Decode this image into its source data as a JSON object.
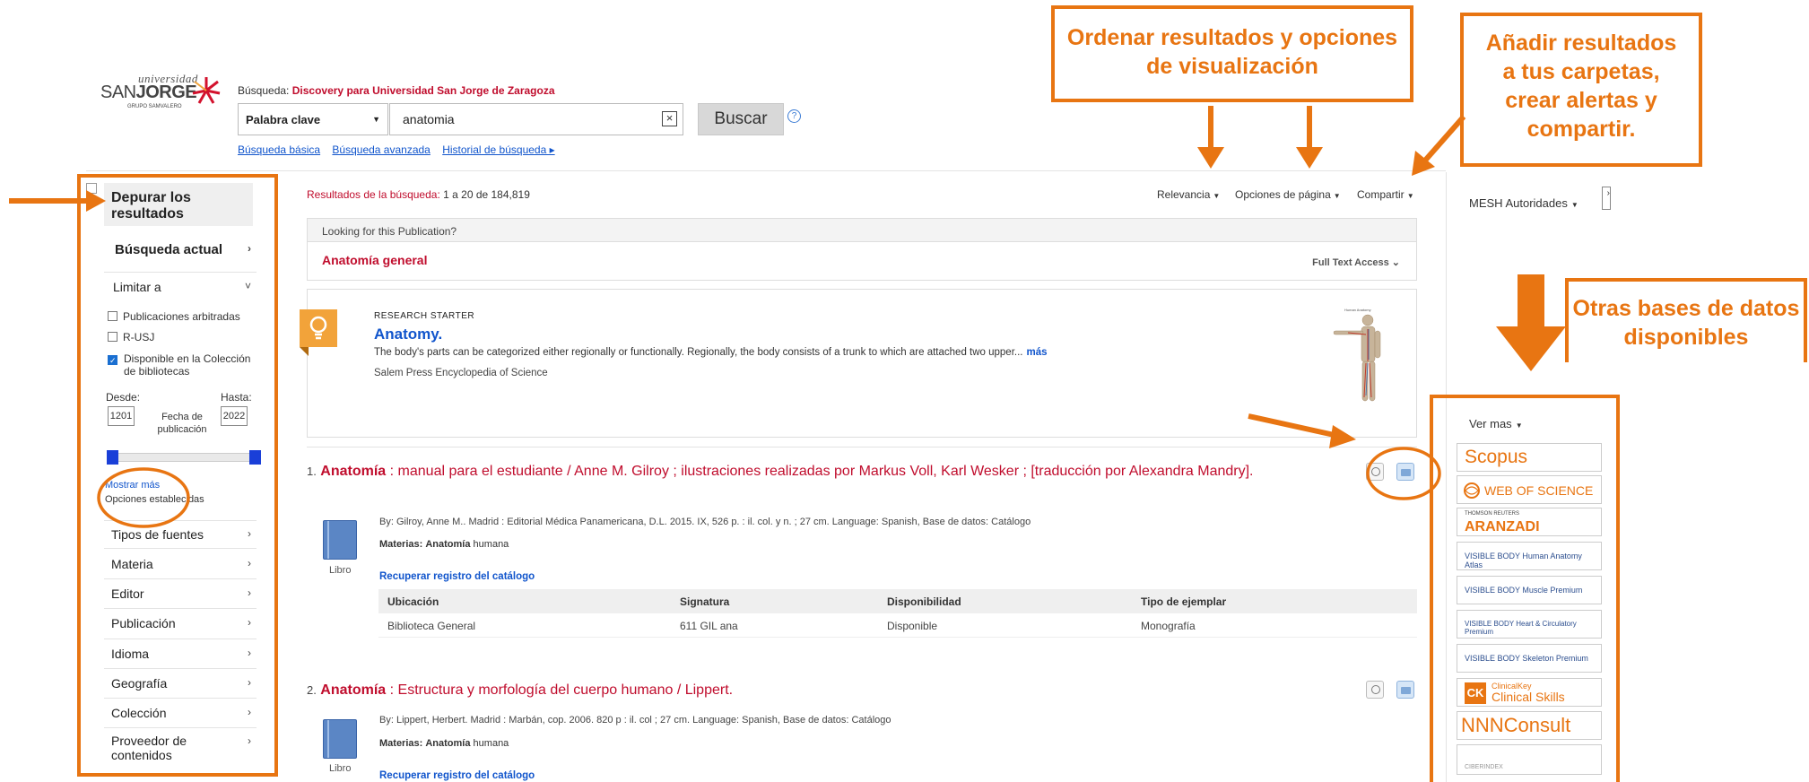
{
  "header": {
    "logo_top": "universidad",
    "logo_main_a": "SAN",
    "logo_main_b": "JORGE",
    "logo_sub": "GRUPO SAMVALERO",
    "search_label": "Búsqueda:",
    "search_target": "Discovery para Universidad San Jorge de Zaragoza",
    "field_select": "Palabra clave",
    "query": "anatomia",
    "search_button": "Buscar",
    "help": "?",
    "links": [
      "Búsqueda básica",
      "Búsqueda avanzada",
      "Historial de búsqueda ▸"
    ]
  },
  "sidebar": {
    "refine_title": "Depurar los resultados",
    "current_search": "Búsqueda actual",
    "limit_label": "Limitar a",
    "limits": [
      {
        "label": "Publicaciones arbitradas",
        "checked": false
      },
      {
        "label": "R-USJ",
        "checked": false
      },
      {
        "label": "Disponible en la Colección de bibliotecas",
        "checked": true
      }
    ],
    "from_label": "Desde:",
    "to_label": "Hasta:",
    "from_value": "1201",
    "to_value": "2022",
    "date_label": "Fecha de publicación",
    "show_more": "Mostrar más",
    "set_options": "Opciones establecidas",
    "facets": [
      "Tipos de fuentes",
      "Materia",
      "Editor",
      "Publicación",
      "Idioma",
      "Geografía",
      "Colección",
      "Proveedor de contenidos"
    ]
  },
  "results": {
    "count_label": "Resultados de la búsqueda:",
    "count_value": "1 a 20 de 184,819",
    "sort": "Relevancia",
    "page_options": "Opciones de página",
    "share": "Compartir",
    "pub_prompt": "Looking for this Publication?",
    "pub_title": "Anatomía general",
    "full_text": "Full Text Access",
    "research_starter": {
      "kicker": "RESEARCH STARTER",
      "title": "Anatomy.",
      "text": "The body's parts can be categorized either regionally or functionally. Regionally, the body consists of a trunk to which are attached two upper...",
      "more": "más",
      "source": "Salem Press Encyclopedia of Science"
    },
    "items": [
      {
        "num": "1.",
        "title_bold": "Anatomía",
        "title_rest": ": manual para el estudiante / Anne M. Gilroy ; ilustraciones realizadas por Markus Voll, Karl Wesker ; [traducción por Alexandra Mandry].",
        "type": "Libro",
        "meta": "By: Gilroy, Anne M.. Madrid : Editorial Médica Panamericana, D.L. 2015. IX, 526 p. : il. col. y n. ; 27 cm. Language: Spanish, Base de datos: Catálogo",
        "materias_label": "Materias:",
        "materias_bold": "Anatomía",
        "materias_rest": "humana",
        "link": "Recuperar registro del catálogo",
        "holdings_headers": [
          "Ubicación",
          "Signatura",
          "Disponibilidad",
          "Tipo de ejemplar"
        ],
        "holdings_row": [
          "Biblioteca General",
          "611 GIL ana",
          "Disponible",
          "Monografía"
        ]
      },
      {
        "num": "2.",
        "title_bold": "Anatomía",
        "title_rest": ": Estructura y morfología del cuerpo humano / Lippert.",
        "type": "Libro",
        "meta": "By: Lippert, Herbert. Madrid : Marbán, cop. 2006. 820 p : il. col ; 27 cm. Language: Spanish, Base de datos: Catálogo",
        "materias_label": "Materias:",
        "materias_bold": "Anatomía",
        "materias_rest": "humana",
        "link": "Recuperar registro del catálogo"
      }
    ]
  },
  "right": {
    "mesh": "MESH Autoridades",
    "ver_mas": "Ver mas",
    "databases": [
      "Scopus",
      "WEB OF SCIENCE",
      "THOMSON REUTERS",
      "ARANZADI",
      "VISIBLE BODY Human Anatomy Atlas",
      "VISIBLE BODY Muscle Premium",
      "VISIBLE BODY Heart & Circulatory Premium",
      "VISIBLE BODY Skeleton Premium",
      "CK",
      "ClinicalKey",
      "Clinical Skills",
      "NNNConsult",
      "CIBERINDEX"
    ]
  },
  "annotations": {
    "sort_note": "Ordenar resultados y opciones de visualización",
    "folder_note": "Añadir resultados a tus carpetas, crear alertas y compartir.",
    "db_note": "Otras bases de datos disponibles"
  },
  "colors": {
    "accent_red": "#c00d2d",
    "link_blue": "#1155cc",
    "annotation_orange": "#e87512"
  }
}
